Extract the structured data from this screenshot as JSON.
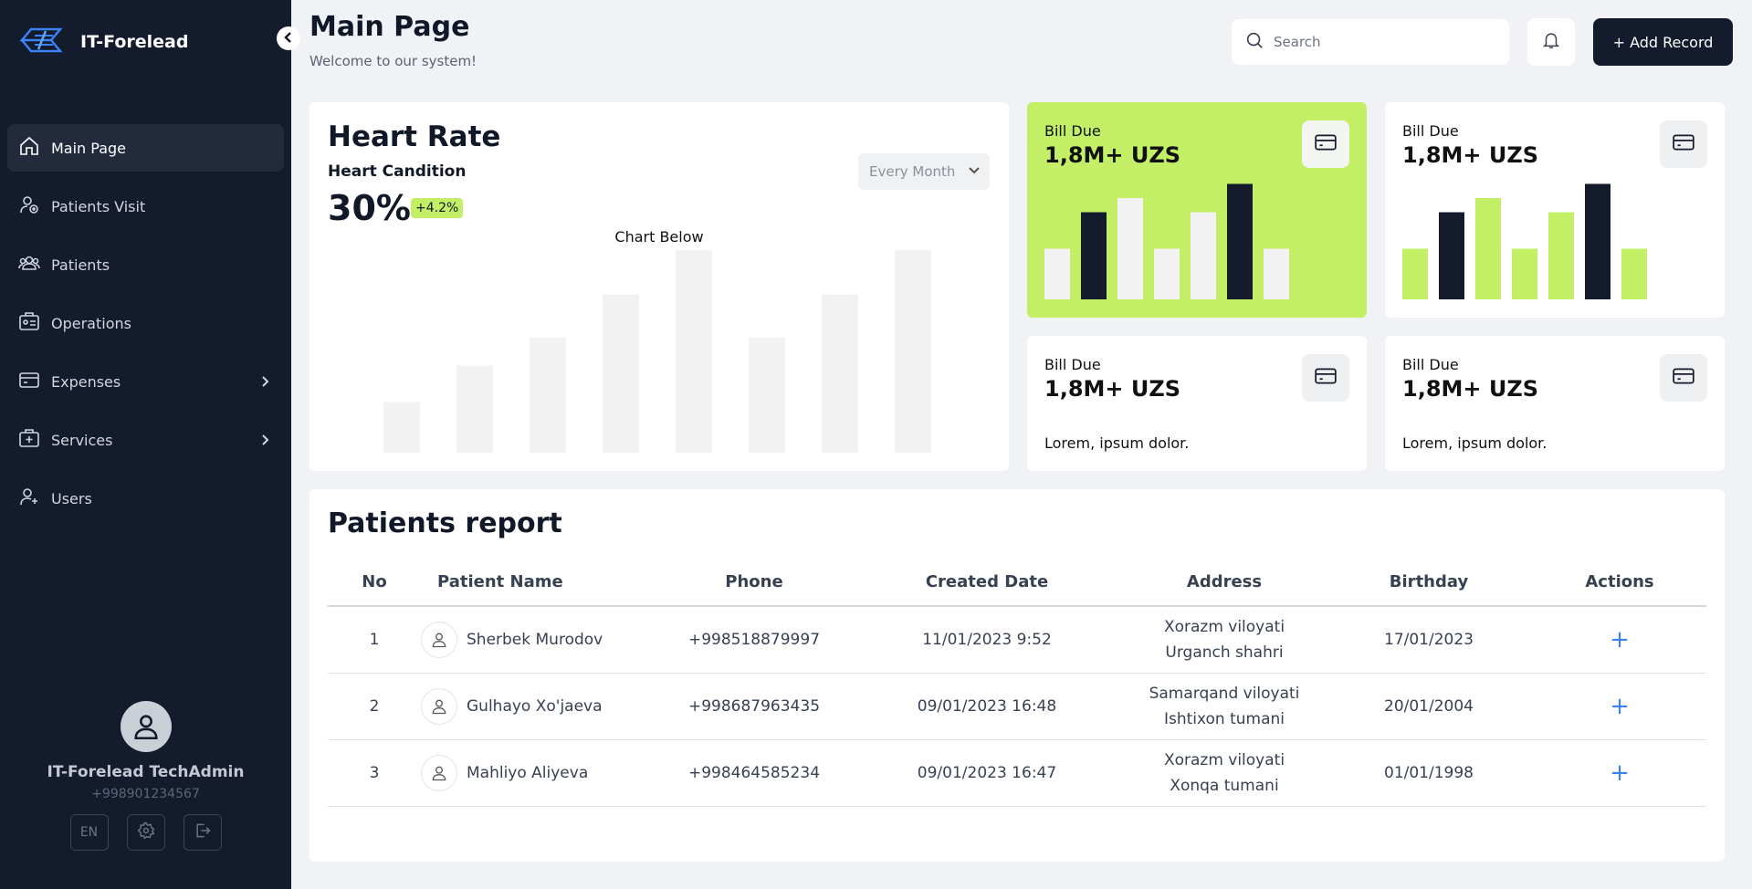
{
  "sidebar": {
    "brand": "IT-Forelead",
    "items": [
      {
        "label": "Main Page",
        "icon": "home-icon",
        "active": true
      },
      {
        "label": "Patients Visit",
        "icon": "user-add-icon"
      },
      {
        "label": "Patients",
        "icon": "users-icon"
      },
      {
        "label": "Operations",
        "icon": "operations-icon"
      },
      {
        "label": "Expenses",
        "icon": "wallet-icon",
        "has_submenu": true
      },
      {
        "label": "Services",
        "icon": "medical-case-icon",
        "has_submenu": true
      },
      {
        "label": "Users",
        "icon": "user-plus-icon"
      }
    ],
    "profile": {
      "name": "IT-Forelead TechAdmin",
      "phone": "+998901234567",
      "lang": "EN"
    }
  },
  "header": {
    "title": "Main Page",
    "subtitle": "Welcome to our system!",
    "search_placeholder": "Search",
    "add_label": "+ Add Record"
  },
  "heart_rate": {
    "title": "Heart Rate",
    "subtitle": "Heart Candition",
    "value": "30%",
    "change": "+4.2%",
    "period": "Every Month",
    "chart_caption": "Chart Below"
  },
  "chart_data": {
    "type": "bar",
    "values": [
      25,
      43,
      57,
      78,
      100,
      57,
      78,
      100
    ],
    "ylim": [
      0,
      100
    ],
    "grid": false
  },
  "bills": [
    {
      "title": "Bill Due",
      "amount": "1,8M+ UZS",
      "variant": "green",
      "bars": [
        25,
        43,
        50,
        25,
        43,
        57,
        25
      ],
      "dark_bars": [
        1,
        5
      ]
    },
    {
      "title": "Bill Due",
      "amount": "1,8M+ UZS",
      "variant": "white",
      "bars": [
        25,
        43,
        50,
        25,
        43,
        57,
        25
      ],
      "dark_bars": [
        1,
        5
      ]
    },
    {
      "title": "Bill Due",
      "amount": "1,8M+ UZS",
      "note": "Lorem, ipsum dolor."
    },
    {
      "title": "Bill Due",
      "amount": "1,8M+ UZS",
      "note": "Lorem, ipsum dolor."
    }
  ],
  "colors": {
    "sidebar": "#141b2d",
    "accent": "#c2ef66",
    "dark_bar": "#141b2d",
    "light_bar": "#f2f2f3",
    "action": "#3b82f6"
  },
  "report": {
    "title": "Patients report",
    "columns": [
      "No",
      "Patient Name",
      "Phone",
      "Created Date",
      "Address",
      "Birthday",
      "Actions"
    ],
    "rows": [
      {
        "no": "1",
        "name": "Sherbek Murodov",
        "phone": "+998518879997",
        "created": "11/01/2023 9:52",
        "address1": "Xorazm viloyati",
        "address2": "Urganch shahri",
        "birthday": "17/01/2023",
        "action": "+"
      },
      {
        "no": "2",
        "name": "Gulhayo Xo'jaeva",
        "phone": "+998687963435",
        "created": "09/01/2023 16:48",
        "address1": "Samarqand viloyati",
        "address2": "Ishtixon tumani",
        "birthday": "20/01/2004",
        "action": "+"
      },
      {
        "no": "3",
        "name": "Mahliyo Aliyeva",
        "phone": "+998464585234",
        "created": "09/01/2023 16:47",
        "address1": "Xorazm viloyati",
        "address2": "Xonqa tumani",
        "birthday": "01/01/1998",
        "action": "+"
      }
    ]
  }
}
